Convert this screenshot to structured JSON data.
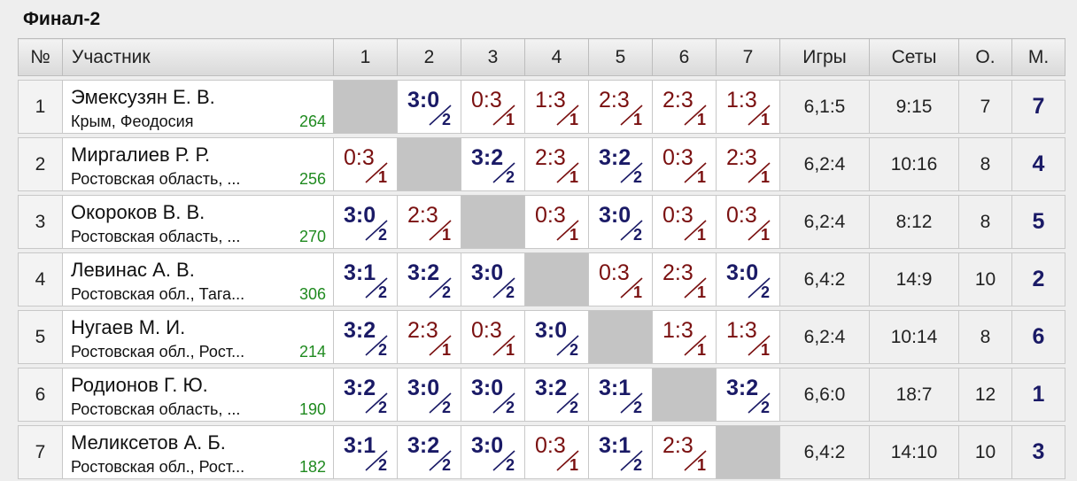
{
  "title": "Финал-2",
  "headers": {
    "no": "№",
    "participant": "Участник",
    "rounds": [
      "1",
      "2",
      "3",
      "4",
      "5",
      "6",
      "7"
    ],
    "games": "Игры",
    "sets": "Сеты",
    "points": "О.",
    "place": "М."
  },
  "colors": {
    "win": "#1a1a66",
    "loss": "#7a1010",
    "rating": "#1f8a1f",
    "self_cell": "#c4c4c4"
  },
  "rows": [
    {
      "no": "1",
      "name": "Эмексузян Е. В.",
      "city": "Крым, Феодосия",
      "rating": "264",
      "results": [
        null,
        {
          "score": "3:0",
          "pts": "2",
          "win": true
        },
        {
          "score": "0:3",
          "pts": "1",
          "win": false
        },
        {
          "score": "1:3",
          "pts": "1",
          "win": false
        },
        {
          "score": "2:3",
          "pts": "1",
          "win": false
        },
        {
          "score": "2:3",
          "pts": "1",
          "win": false
        },
        {
          "score": "1:3",
          "pts": "1",
          "win": false
        }
      ],
      "games": "6,1:5",
      "sets": "9:15",
      "points": "7",
      "place": "7"
    },
    {
      "no": "2",
      "name": "Миргалиев Р. Р.",
      "city": "Ростовская область, ...",
      "rating": "256",
      "results": [
        {
          "score": "0:3",
          "pts": "1",
          "win": false
        },
        null,
        {
          "score": "3:2",
          "pts": "2",
          "win": true
        },
        {
          "score": "2:3",
          "pts": "1",
          "win": false
        },
        {
          "score": "3:2",
          "pts": "2",
          "win": true
        },
        {
          "score": "0:3",
          "pts": "1",
          "win": false
        },
        {
          "score": "2:3",
          "pts": "1",
          "win": false
        }
      ],
      "games": "6,2:4",
      "sets": "10:16",
      "points": "8",
      "place": "4"
    },
    {
      "no": "3",
      "name": "Окороков В. В.",
      "city": "Ростовская область, ...",
      "rating": "270",
      "results": [
        {
          "score": "3:0",
          "pts": "2",
          "win": true
        },
        {
          "score": "2:3",
          "pts": "1",
          "win": false
        },
        null,
        {
          "score": "0:3",
          "pts": "1",
          "win": false
        },
        {
          "score": "3:0",
          "pts": "2",
          "win": true
        },
        {
          "score": "0:3",
          "pts": "1",
          "win": false
        },
        {
          "score": "0:3",
          "pts": "1",
          "win": false
        }
      ],
      "games": "6,2:4",
      "sets": "8:12",
      "points": "8",
      "place": "5"
    },
    {
      "no": "4",
      "name": "Левинас А. В.",
      "city": "Ростовская обл., Тага...",
      "rating": "306",
      "results": [
        {
          "score": "3:1",
          "pts": "2",
          "win": true
        },
        {
          "score": "3:2",
          "pts": "2",
          "win": true
        },
        {
          "score": "3:0",
          "pts": "2",
          "win": true
        },
        null,
        {
          "score": "0:3",
          "pts": "1",
          "win": false
        },
        {
          "score": "2:3",
          "pts": "1",
          "win": false
        },
        {
          "score": "3:0",
          "pts": "2",
          "win": true
        }
      ],
      "games": "6,4:2",
      "sets": "14:9",
      "points": "10",
      "place": "2"
    },
    {
      "no": "5",
      "name": "Нугаев М. И.",
      "city": "Ростовская обл., Рост...",
      "rating": "214",
      "results": [
        {
          "score": "3:2",
          "pts": "2",
          "win": true
        },
        {
          "score": "2:3",
          "pts": "1",
          "win": false
        },
        {
          "score": "0:3",
          "pts": "1",
          "win": false
        },
        {
          "score": "3:0",
          "pts": "2",
          "win": true
        },
        null,
        {
          "score": "1:3",
          "pts": "1",
          "win": false
        },
        {
          "score": "1:3",
          "pts": "1",
          "win": false
        }
      ],
      "games": "6,2:4",
      "sets": "10:14",
      "points": "8",
      "place": "6"
    },
    {
      "no": "6",
      "name": "Родионов Г. Ю.",
      "city": "Ростовская область, ...",
      "rating": "190",
      "results": [
        {
          "score": "3:2",
          "pts": "2",
          "win": true
        },
        {
          "score": "3:0",
          "pts": "2",
          "win": true
        },
        {
          "score": "3:0",
          "pts": "2",
          "win": true
        },
        {
          "score": "3:2",
          "pts": "2",
          "win": true
        },
        {
          "score": "3:1",
          "pts": "2",
          "win": true
        },
        null,
        {
          "score": "3:2",
          "pts": "2",
          "win": true
        }
      ],
      "games": "6,6:0",
      "sets": "18:7",
      "points": "12",
      "place": "1"
    },
    {
      "no": "7",
      "name": "Меликсетов А. Б.",
      "city": "Ростовская обл., Рост...",
      "rating": "182",
      "results": [
        {
          "score": "3:1",
          "pts": "2",
          "win": true
        },
        {
          "score": "3:2",
          "pts": "2",
          "win": true
        },
        {
          "score": "3:0",
          "pts": "2",
          "win": true
        },
        {
          "score": "0:3",
          "pts": "1",
          "win": false
        },
        {
          "score": "3:1",
          "pts": "2",
          "win": true
        },
        {
          "score": "2:3",
          "pts": "1",
          "win": false
        },
        null
      ],
      "games": "6,4:2",
      "sets": "14:10",
      "points": "10",
      "place": "3"
    }
  ]
}
